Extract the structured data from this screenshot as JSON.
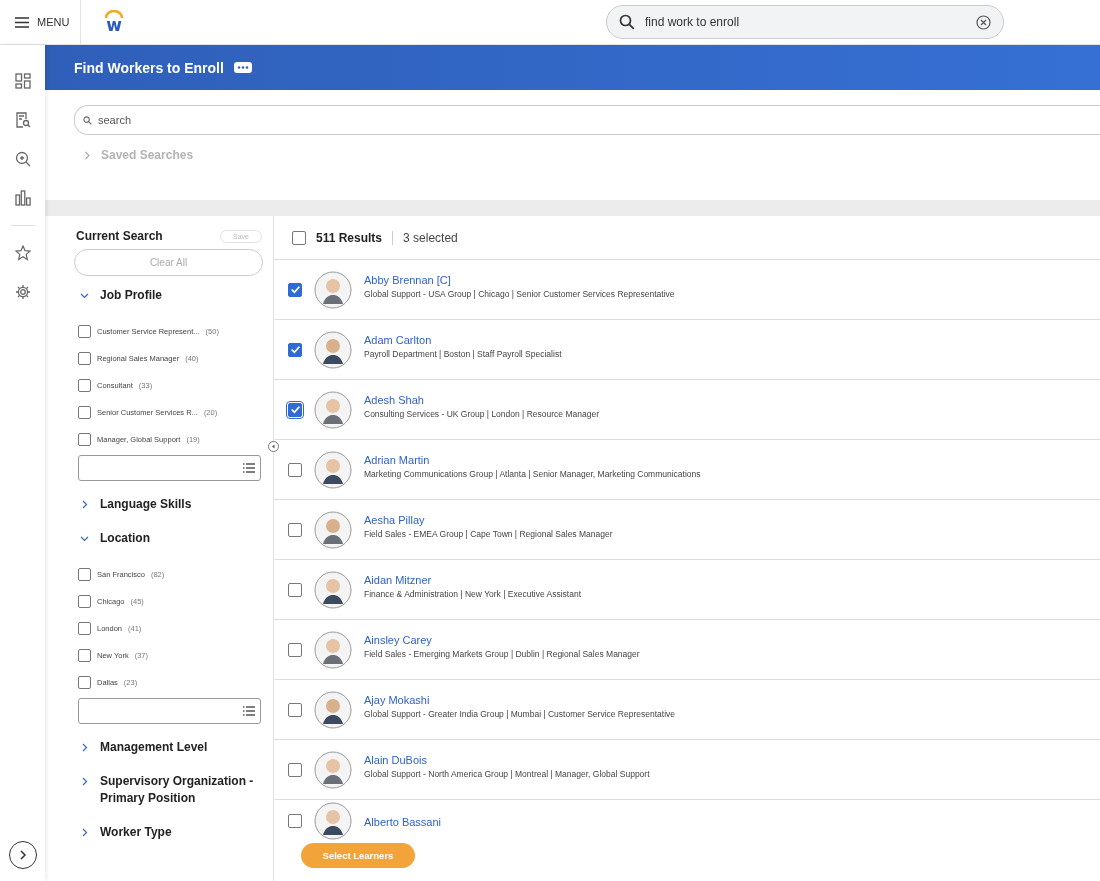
{
  "topbar": {
    "menu_label": "MENU",
    "logo_letter": "w",
    "search_value": "find work to enroll"
  },
  "page": {
    "title": "Find Workers to Enroll",
    "search_placeholder": "search",
    "saved_searches": "Saved Searches"
  },
  "filters": {
    "title": "Current Search",
    "save_label": "Save",
    "clear_label": "Clear All",
    "sections": [
      {
        "title": "Job Profile",
        "expanded": true,
        "options": [
          {
            "label": "Customer Service Represent...",
            "count": "(50)",
            "checked": false
          },
          {
            "label": "Regional Sales Manager",
            "count": "(40)",
            "checked": false
          },
          {
            "label": "Consultant",
            "count": "(33)",
            "checked": false
          },
          {
            "label": "Senior Customer Services R...",
            "count": "(20)",
            "checked": false
          },
          {
            "label": "Manager, Global Support",
            "count": "(19)",
            "checked": false
          }
        ]
      },
      {
        "title": "Language Skills",
        "expanded": false
      },
      {
        "title": "Location",
        "expanded": true,
        "options": [
          {
            "label": "San Francisco",
            "count": "(82)",
            "checked": false
          },
          {
            "label": "Chicago",
            "count": "(45)",
            "checked": false
          },
          {
            "label": "London",
            "count": "(41)",
            "checked": false
          },
          {
            "label": "New York",
            "count": "(37)",
            "checked": false
          },
          {
            "label": "Dallas",
            "count": "(23)",
            "checked": false
          }
        ]
      },
      {
        "title": "Management Level",
        "expanded": false
      },
      {
        "title": "Supervisory Organization - Primary Position",
        "expanded": false
      },
      {
        "title": "Worker Type",
        "expanded": false
      }
    ]
  },
  "results": {
    "count": "511 Results",
    "selected_count": "3 selected",
    "all_selected": false,
    "rows": [
      {
        "name": "Abby Brennan [C]",
        "details": "Global Support - USA Group | Chicago | Senior Customer Services Representative",
        "selected": true
      },
      {
        "name": "Adam Carlton",
        "details": "Payroll Department | Boston | Staff Payroll Specialist",
        "selected": true
      },
      {
        "name": "Adesh Shah",
        "details": "Consulting Services - UK Group | London | Resource Manager",
        "selected": true
      },
      {
        "name": "Adrian Martin",
        "details": "Marketing Communications Group | Atlanta | Senior Manager, Marketing Communications",
        "selected": false
      },
      {
        "name": "Aesha Pillay",
        "details": "Field Sales - EMEA Group | Cape Town | Regional Sales Manager",
        "selected": false
      },
      {
        "name": "Aidan Mitzner",
        "details": "Finance & Administration | New York | Executive Assistant",
        "selected": false
      },
      {
        "name": "Ainsley Carey",
        "details": "Field Sales - Emerging Markets Group | Dublin | Regional Sales Manager",
        "selected": false
      },
      {
        "name": "Ajay Mokashi",
        "details": "Global Support - Greater India Group | Mumbai | Customer Service Representative",
        "selected": false
      },
      {
        "name": "Alain DuBois",
        "details": "Global Support - North America Group | Montreal | Manager, Global Support",
        "selected": false
      },
      {
        "name": "Alberto Bassani",
        "selected": false
      }
    ]
  },
  "footer": {
    "button": "Select Learners"
  }
}
